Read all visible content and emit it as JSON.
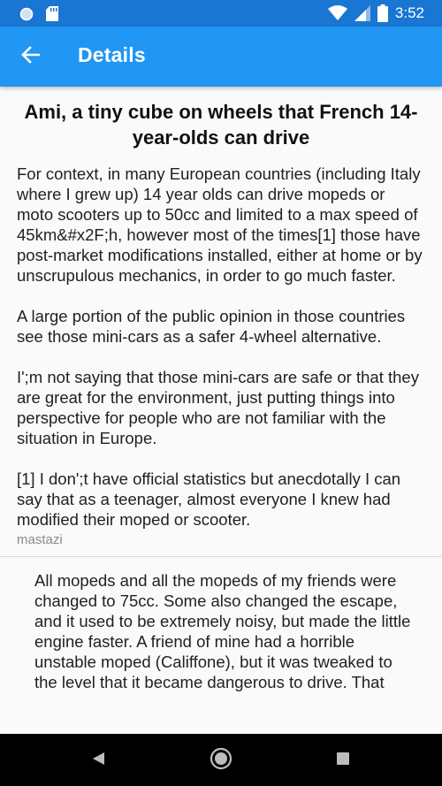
{
  "status_bar": {
    "time": "3:52",
    "icons": [
      "circle-icon",
      "sd-card-icon",
      "wifi-icon",
      "signal-icon",
      "battery-icon"
    ],
    "background": "#1976d2"
  },
  "app_bar": {
    "title": "Details",
    "back_icon": "arrow-back-icon",
    "background": "#2196f3"
  },
  "story": {
    "title": "Ami, a tiny cube on wheels that French 14-year-olds can drive",
    "paragraphs": [
      "For context, in many European countries (including Italy where I grew up) 14 year olds can drive mopeds or moto scooters up to 50cc and limited to a max speed of 45km&#x2F;h, however most of the times[1] those have post-market modifications installed, either at home or by unscrupulous mechanics, in order to go much faster.",
      "A large portion of the public opinion in those countries see those mini-cars as a safer 4-wheel alternative.",
      "I';m not saying that those mini-cars are safe or that they are great for the environment, just putting things into perspective for people who are not familiar with the situation in Europe.",
      "[1] I don';t have official statistics but anecdotally I can say that as a teenager, almost everyone I knew had modified their moped or scooter."
    ],
    "author": "mastazi"
  },
  "comment": {
    "text": "All mopeds and all the mopeds of my friends were changed to 75cc. Some also changed the escape, and it used to be extremely noisy, but made the little engine faster. A friend of mine had a horrible unstable moped (Califfone), but it was tweaked to the level that it became dangerous to drive. That"
  },
  "nav_bar": {
    "buttons": [
      "back-triangle-icon",
      "home-circle-icon",
      "recents-square-icon"
    ]
  }
}
